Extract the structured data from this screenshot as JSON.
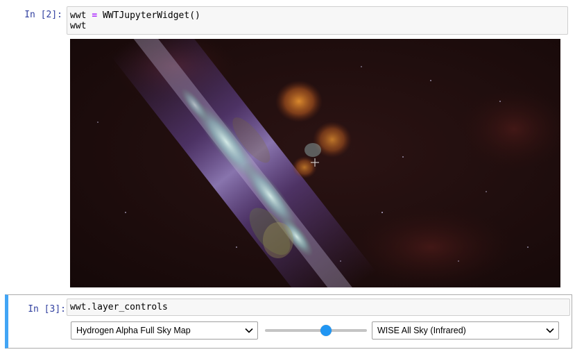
{
  "cells": [
    {
      "prompt": "In [2]:",
      "code_lines": [
        "wwt = WWTJupyterWidget()",
        "wwt"
      ],
      "code_line1_parts": {
        "lhs": "wwt ",
        "op": "=",
        "rhs": " WWTJupyterWidget()"
      }
    },
    {
      "prompt": "In [3]:",
      "code_lines": [
        "wwt.layer_controls"
      ]
    }
  ],
  "widget": {
    "foreground_select": {
      "value": "Hydrogen Alpha Full Sky Map"
    },
    "opacity_slider": {
      "value": 0.6
    },
    "background_select": {
      "value": "WISE All Sky (Infrared)"
    }
  },
  "colors": {
    "prompt": "#303f9f",
    "selected_cell_bar": "#42a5f5",
    "slider_thumb": "#2196f3",
    "sky_background": "#1a0c0c"
  },
  "icons": {
    "crosshair": "crosshair-icon",
    "dropdown": "chevron-down-icon"
  }
}
